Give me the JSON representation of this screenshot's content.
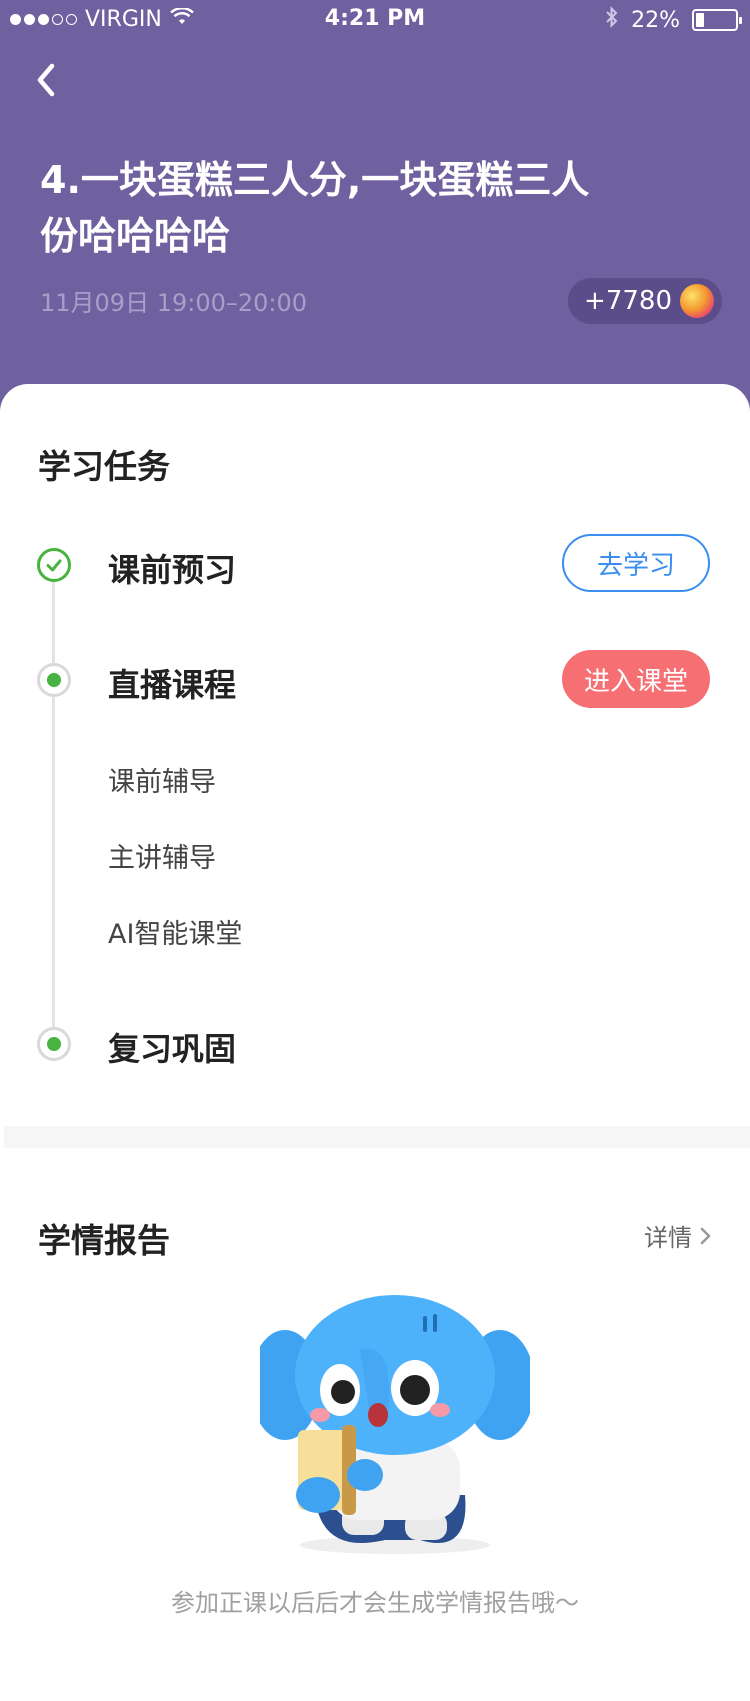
{
  "status_bar": {
    "carrier": "VIRGIN",
    "time": "4:21 PM",
    "battery": "22%",
    "battery_level": 0.22,
    "signal_bars": 3,
    "signal_total": 5
  },
  "header": {
    "title": "4.一块蛋糕三人分,一块蛋糕三人份哈哈哈哈",
    "datetime": "11月09日 19:00–20:00",
    "points": "+7780"
  },
  "tasks": {
    "section_title": "学习任务",
    "items": [
      {
        "label": "课前预习",
        "button": "去学习",
        "status": "done"
      },
      {
        "label": "直播课程",
        "button": "进入课堂",
        "status": "current"
      },
      {
        "label": "复习巩固",
        "status": "current"
      }
    ],
    "sub_items": [
      "课前辅导",
      "主讲辅导",
      "AI智能课堂"
    ]
  },
  "report": {
    "section_title": "学情报告",
    "detail_link": "详情",
    "empty_message": "参加正课以后后才会生成学情报告哦～"
  },
  "colors": {
    "header_bg": "#6f61a0",
    "primary_blue": "#3a8ef0",
    "enter_red": "#f56f73",
    "done_green": "#48b33f"
  }
}
